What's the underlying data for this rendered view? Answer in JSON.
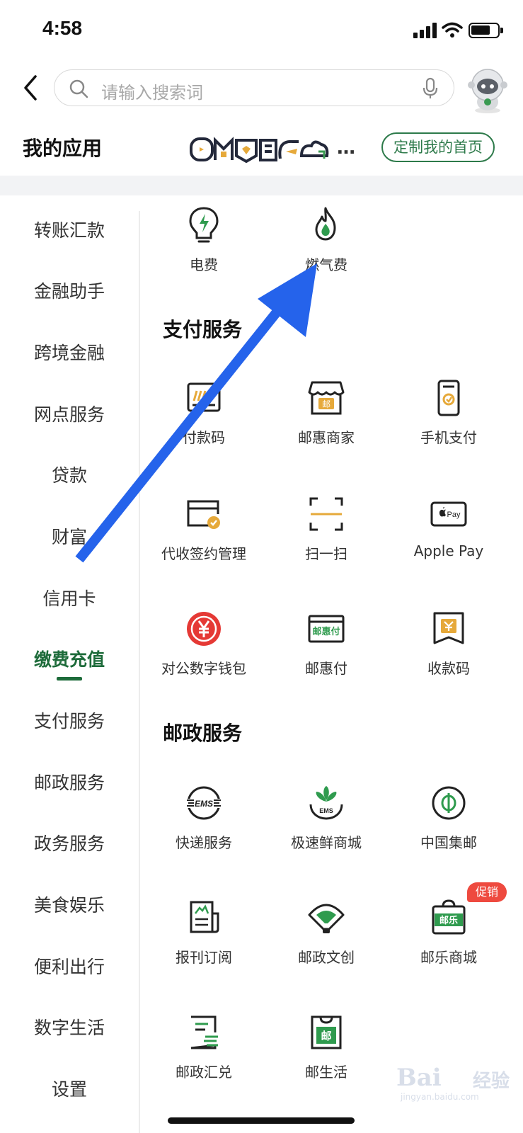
{
  "status_bar": {
    "time": "4:58"
  },
  "header": {
    "search_placeholder": "请输入搜索词"
  },
  "my_apps": {
    "title": "我的应用",
    "strip_text": "…",
    "customize_label": "定制我的首页"
  },
  "sidebar": {
    "items": [
      {
        "label": "转账汇款"
      },
      {
        "label": "金融助手"
      },
      {
        "label": "跨境金融"
      },
      {
        "label": "网点服务"
      },
      {
        "label": "贷款"
      },
      {
        "label": "财富"
      },
      {
        "label": "信用卡"
      },
      {
        "label": "缴费充值",
        "active": true
      },
      {
        "label": "支付服务"
      },
      {
        "label": "邮政服务"
      },
      {
        "label": "政务服务"
      },
      {
        "label": "美食娱乐"
      },
      {
        "label": "便利出行"
      },
      {
        "label": "数字生活"
      },
      {
        "label": "设置"
      }
    ]
  },
  "content": {
    "top_items": [
      {
        "label": "电费",
        "icon": "bulb-bolt-icon"
      },
      {
        "label": "燃气费",
        "icon": "flame-icon"
      }
    ],
    "sections": [
      {
        "title": "支付服务",
        "items": [
          {
            "label": "付款码",
            "icon": "payment-code-icon"
          },
          {
            "label": "邮惠商家",
            "icon": "merchant-store-icon"
          },
          {
            "label": "手机支付",
            "icon": "mobile-pay-icon"
          },
          {
            "label": "代收签约管理",
            "icon": "contract-manage-icon"
          },
          {
            "label": "扫一扫",
            "icon": "scan-icon"
          },
          {
            "label": "Apple Pay",
            "icon": "apple-pay-icon"
          },
          {
            "label": "对公数字钱包",
            "icon": "digital-yuan-icon"
          },
          {
            "label": "邮惠付",
            "icon": "youhuifu-icon"
          },
          {
            "label": "收款码",
            "icon": "receive-code-icon"
          }
        ]
      },
      {
        "title": "邮政服务",
        "items": [
          {
            "label": "快递服务",
            "icon": "ems-icon"
          },
          {
            "label": "极速鲜商城",
            "icon": "fresh-mall-icon"
          },
          {
            "label": "中国集邮",
            "icon": "philately-icon"
          },
          {
            "label": "报刊订阅",
            "icon": "newspaper-icon"
          },
          {
            "label": "邮政文创",
            "icon": "fan-icon"
          },
          {
            "label": "邮乐商城",
            "icon": "youle-mall-icon",
            "badge": "促销"
          },
          {
            "label": "邮政汇兑",
            "icon": "remittance-icon"
          },
          {
            "label": "邮生活",
            "icon": "post-life-icon"
          }
        ]
      }
    ]
  },
  "watermark": {
    "logo": "Bai",
    "text": "经验",
    "domain": "jingyan.baidu.com"
  },
  "colors": {
    "brand_green": "#1d6b3a",
    "arrow_blue": "#2563eb",
    "promo_red": "#ee4a3f"
  }
}
